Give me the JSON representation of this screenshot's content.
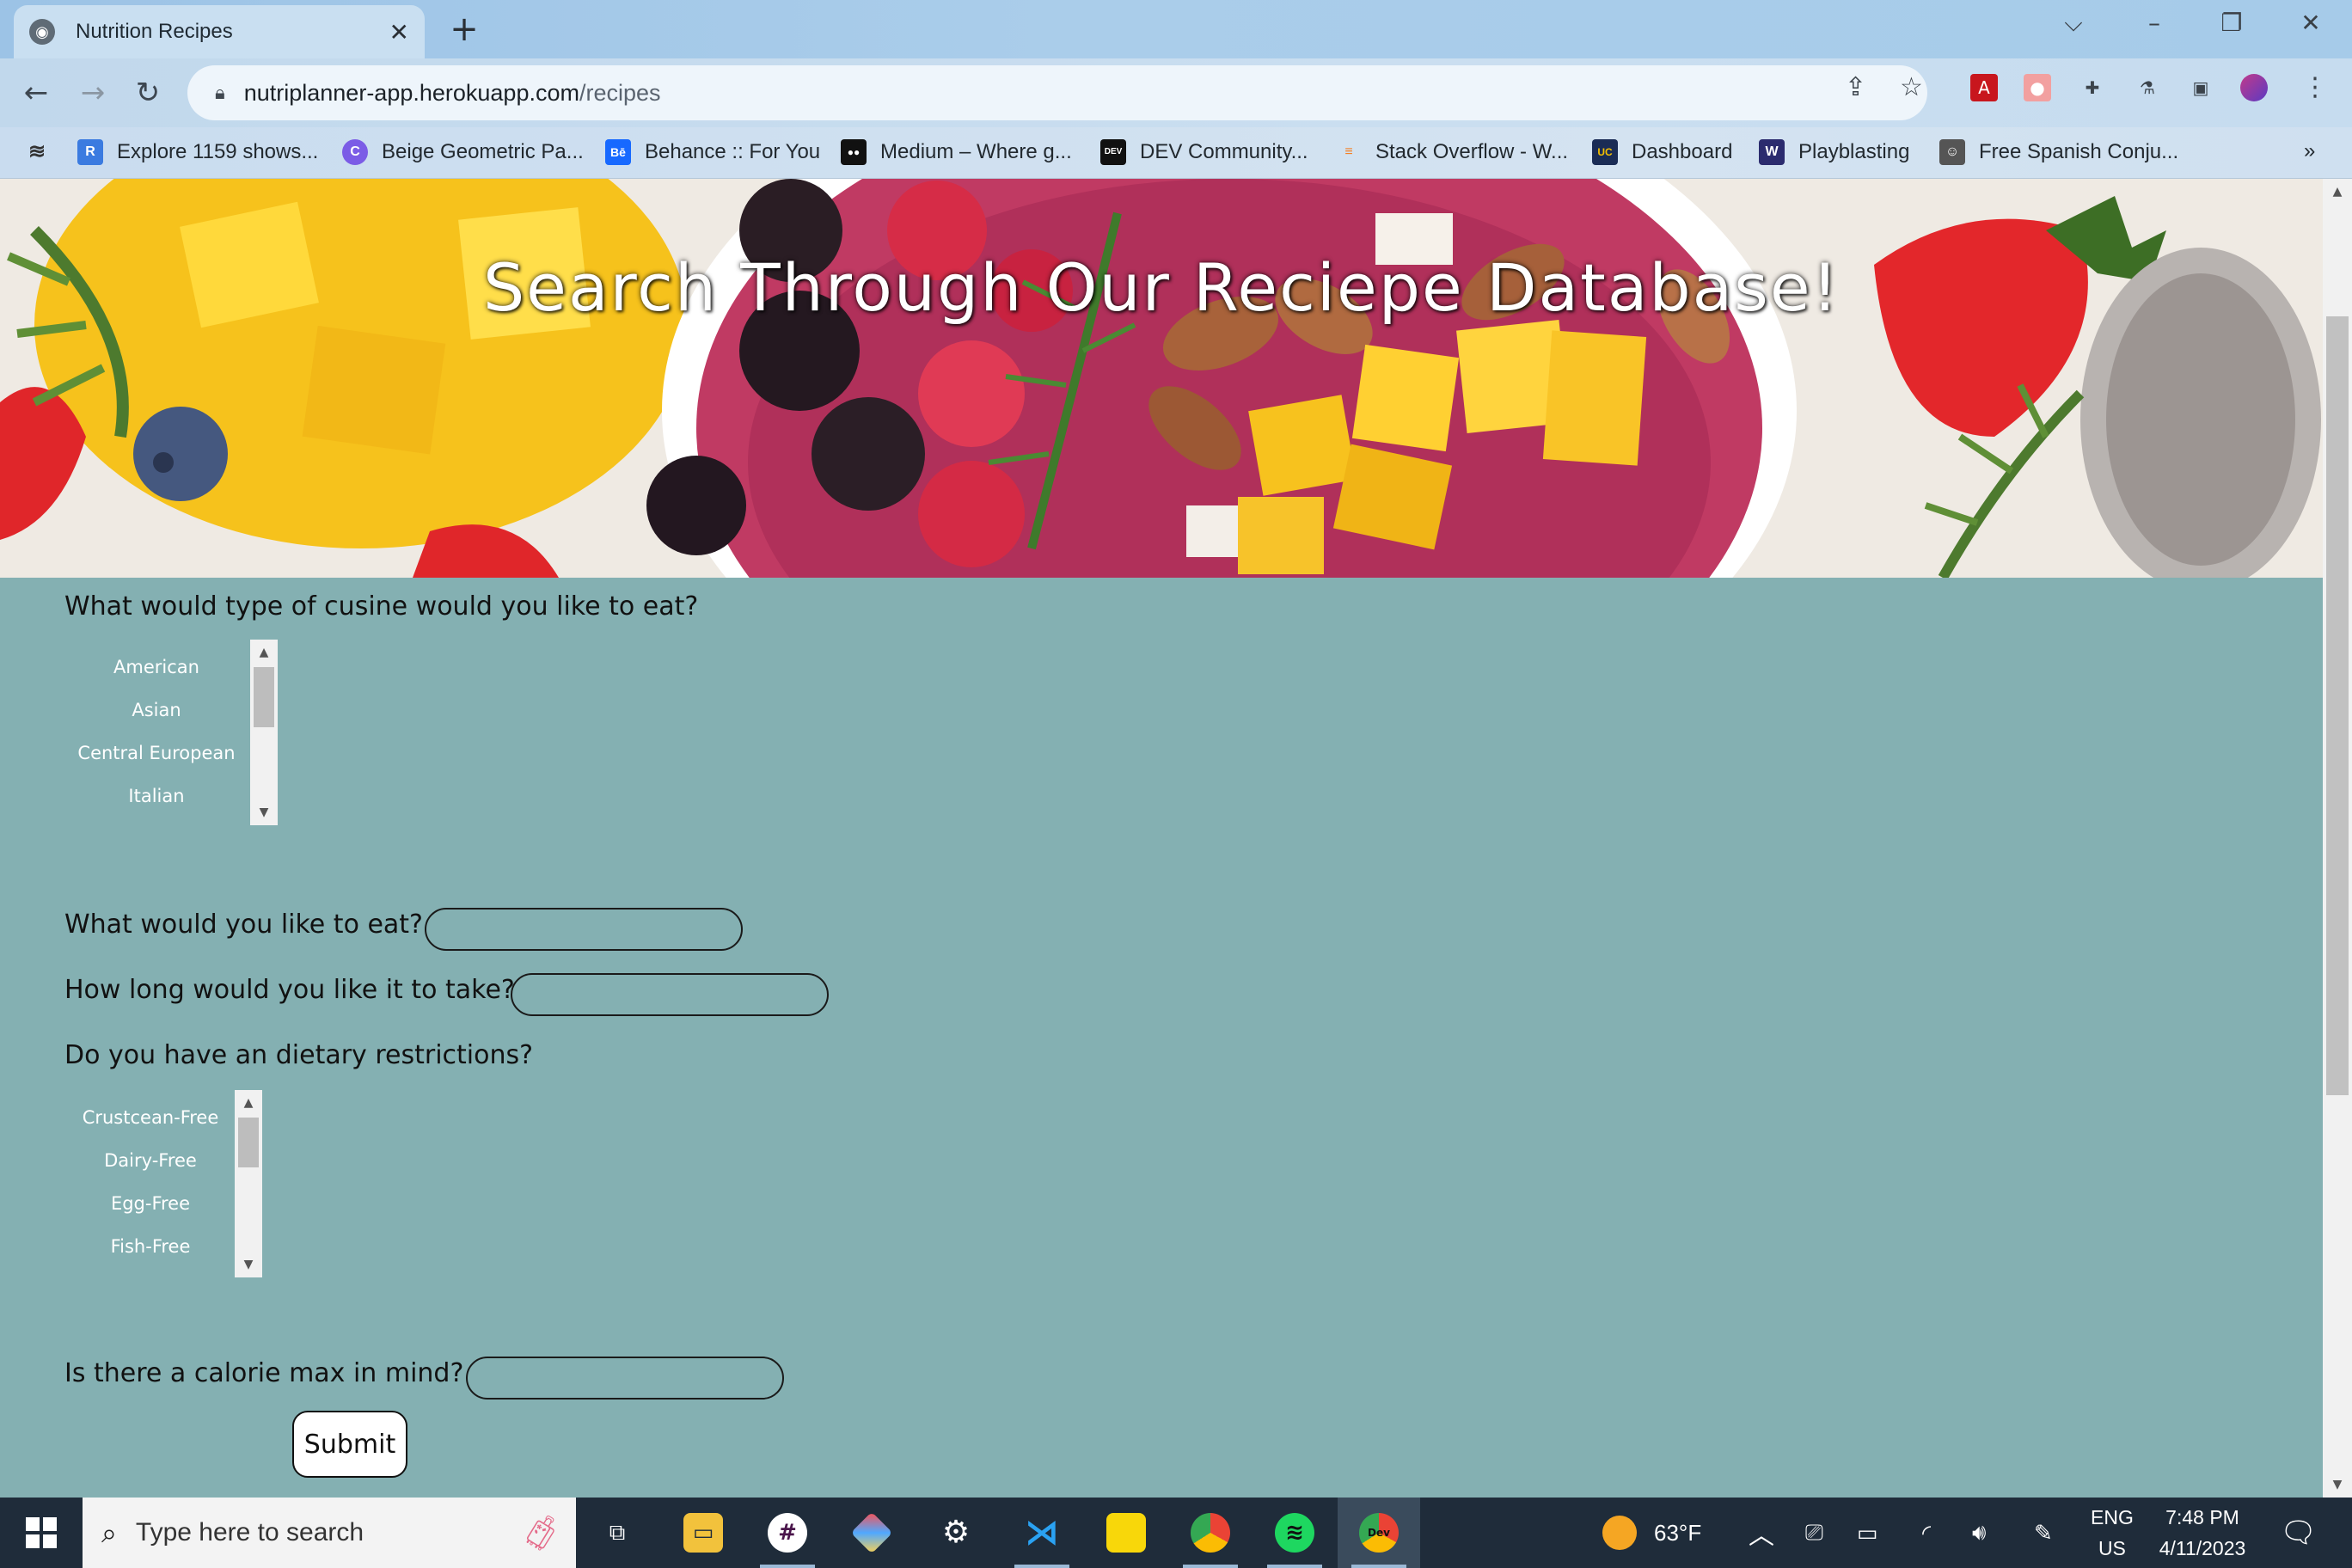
{
  "browser": {
    "tab_title": "Nutrition Recipes",
    "tab_close": "✕",
    "new_tab": "+",
    "url_host": "nutriplanner-app.herokuapp.com",
    "url_path": "/recipes",
    "bookmarks": [
      {
        "label": "Explore 1159 shows...",
        "icon": "R",
        "color": "#3b7be0"
      },
      {
        "label": "Beige Geometric Pa...",
        "icon": "C",
        "color": "#7b5ce6"
      },
      {
        "label": "Behance :: For You",
        "icon": "Bē",
        "color": "#1769ff"
      },
      {
        "label": "Medium – Where g...",
        "icon": "●●",
        "color": "#111111"
      },
      {
        "label": "DEV Community...",
        "icon": "DEV",
        "color": "#111111"
      },
      {
        "label": "Stack Overflow - W...",
        "icon": "≡",
        "color": "#f48024"
      },
      {
        "label": "Dashboard",
        "icon": "UC",
        "color": "#1a2c55"
      },
      {
        "label": "Playblasting",
        "icon": "W",
        "color": "#2b2b6e"
      },
      {
        "label": "Free Spanish Conju...",
        "icon": "☺",
        "color": "#555555"
      }
    ],
    "more_bookmarks": "»"
  },
  "hero": {
    "title": "Search Through Our Reciepe Database!"
  },
  "form": {
    "cuisine_question": "What would type of cusine would you like to eat?",
    "cuisine_options": [
      "American",
      "Asian",
      "Central European",
      "Italian"
    ],
    "eat_question": "What would you like to eat?",
    "time_question": "How long would you like it to take?",
    "diet_question": "Do you have an dietary restrictions?",
    "diet_options": [
      "Crustcean-Free",
      "Dairy-Free",
      "Egg-Free",
      "Fish-Free"
    ],
    "calorie_question": "Is there a calorie max in mind?",
    "submit_label": "Submit"
  },
  "taskbar": {
    "search_placeholder": "Type here to search",
    "weather": "63°F",
    "lang_top": "ENG",
    "lang_bottom": "US",
    "time": "7:48 PM",
    "date": "4/11/2023"
  },
  "colors": {
    "page_bg": "#84b0b2",
    "taskbar_bg": "#1f2c3a"
  }
}
